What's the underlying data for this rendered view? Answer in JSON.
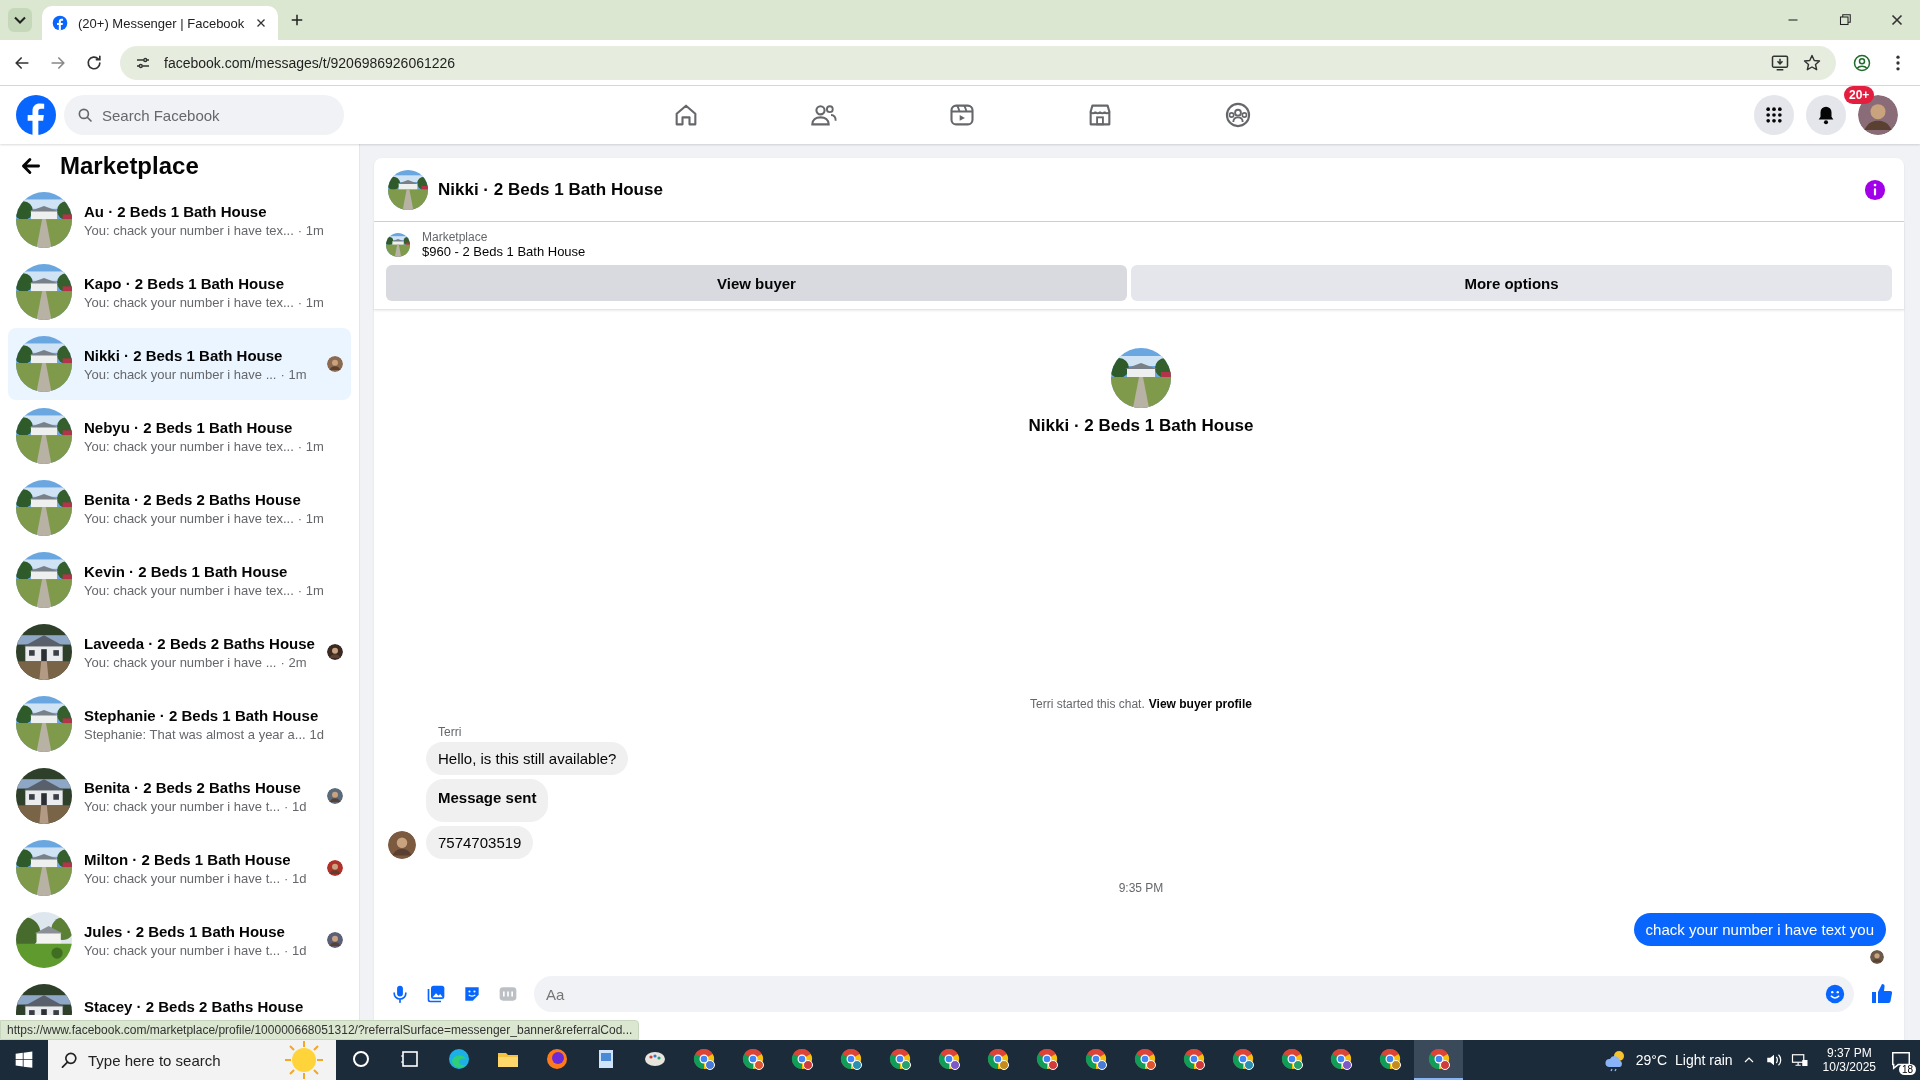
{
  "browser": {
    "tab_title": "(20+) Messenger | Facebook",
    "url": "facebook.com/messages/t/9206986926061226"
  },
  "header": {
    "search_placeholder": "Search Facebook",
    "notification_badge": "20+"
  },
  "sidebar": {
    "title": "Marketplace",
    "conversations": [
      {
        "title": "Au · 2 Beds 1 Bath House",
        "preview": "You: chack your number i have tex...",
        "time": "· 1m",
        "selected": false,
        "read_avatar": false
      },
      {
        "title": "Kapo · 2 Beds 1 Bath House",
        "preview": "You: chack your number i have tex...",
        "time": "· 1m",
        "selected": false,
        "read_avatar": false
      },
      {
        "title": "Nikki · 2 Beds 1 Bath House",
        "preview": "You: chack your number i have ...",
        "time": "· 1m",
        "selected": true,
        "read_avatar": true
      },
      {
        "title": "Nebyu · 2 Beds 1 Bath House",
        "preview": "You: chack your number i have tex...",
        "time": "· 1m",
        "selected": false,
        "read_avatar": false
      },
      {
        "title": "Benita · 2 Beds 2 Baths House",
        "preview": "You: chack your number i have tex...",
        "time": "· 1m",
        "selected": false,
        "read_avatar": false
      },
      {
        "title": "Kevin · 2 Beds 1 Bath House",
        "preview": "You: chack your number i have tex...",
        "time": "· 1m",
        "selected": false,
        "read_avatar": false
      },
      {
        "title": "Laveeda · 2 Beds 2 Baths House",
        "preview": "You: chack your number i have ...",
        "time": "· 2m",
        "selected": false,
        "read_avatar": true
      },
      {
        "title": "Stephanie · 2 Beds 1 Bath House",
        "preview": "Stephanie: That was almost a year a...",
        "time": "1d",
        "selected": false,
        "read_avatar": false
      },
      {
        "title": "Benita · 2 Beds 2 Baths House",
        "preview": "You: chack your number i have t...",
        "time": "· 1d",
        "selected": false,
        "read_avatar": true
      },
      {
        "title": "Milton · 2 Beds 1 Bath House",
        "preview": "You: chack your number i have t...",
        "time": "· 1d",
        "selected": false,
        "read_avatar": true
      },
      {
        "title": "Jules · 2 Beds 1 Bath House",
        "preview": "You: chack your number i have t...",
        "time": "· 1d",
        "selected": false,
        "read_avatar": true
      },
      {
        "title": "Stacey · 2 Beds 2 Baths House",
        "selected": false,
        "read_avatar": false
      }
    ]
  },
  "chat": {
    "title": "Nikki · 2 Beds 1 Bath House",
    "listing": {
      "label": "Marketplace",
      "price_title": "$960 - 2 Beds 1 Bath House"
    },
    "buttons": [
      "View buyer",
      "More options"
    ],
    "profile_name": "Nikki · 2 Beds 1 Bath House",
    "notice": {
      "text": "Terri started this chat.",
      "link": "View buyer profile"
    },
    "sender": "Terri",
    "messages": [
      {
        "kind": "incoming",
        "text": "Hello, is this still available?",
        "avatar": false
      },
      {
        "kind": "status",
        "text": "Message sent",
        "avatar": false
      },
      {
        "kind": "incoming",
        "text": "7574703519",
        "avatar": true
      },
      {
        "kind": "timestamp",
        "text": "9:35 PM"
      },
      {
        "kind": "outgoing",
        "text": "chack your number i have text you"
      }
    ],
    "read_avatar": true,
    "composer_placeholder": "Aa"
  },
  "status_url": "https://www.facebook.com/marketplace/profile/100000668051312/?referralSurface=messenger_banner&referralCod...",
  "taskbar": {
    "search_placeholder": "Type here to search",
    "apps": [
      {
        "kind": "cortana"
      },
      {
        "kind": "taskview"
      },
      {
        "kind": "edge"
      },
      {
        "kind": "files"
      },
      {
        "kind": "firefox"
      },
      {
        "kind": "notepad"
      },
      {
        "kind": "paint"
      },
      {
        "kind": "chrome",
        "selected": false
      },
      {
        "kind": "chrome",
        "selected": false
      },
      {
        "kind": "chrome",
        "selected": false
      },
      {
        "kind": "chrome",
        "selected": false
      },
      {
        "kind": "chrome",
        "selected": false
      },
      {
        "kind": "chrome",
        "selected": false
      },
      {
        "kind": "chrome",
        "selected": false
      },
      {
        "kind": "chrome",
        "selected": false
      },
      {
        "kind": "chrome",
        "selected": false
      },
      {
        "kind": "chrome",
        "selected": false
      },
      {
        "kind": "chrome",
        "selected": false
      },
      {
        "kind": "chrome",
        "selected": false
      },
      {
        "kind": "chrome",
        "selected": false
      },
      {
        "kind": "chrome",
        "selected": false
      },
      {
        "kind": "chrome",
        "selected": false
      },
      {
        "kind": "chrome",
        "selected": true
      }
    ],
    "temperature": "29°C",
    "weather": "Light rain",
    "time": "9:37 PM",
    "date": "10/3/2025",
    "notification_count": "18"
  }
}
